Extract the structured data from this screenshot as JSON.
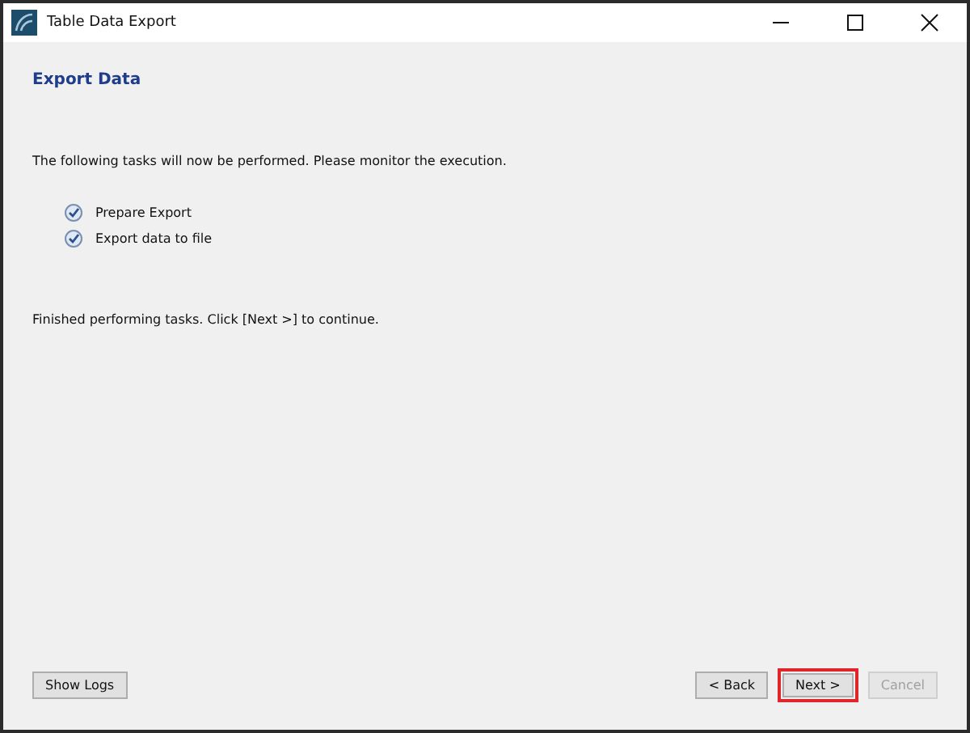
{
  "window": {
    "title": "Table Data Export"
  },
  "page_title": "Export Data",
  "intro": "The following tasks will now be performed. Please monitor the execution.",
  "tasks": [
    {
      "label": "Prepare Export",
      "checked": true
    },
    {
      "label": "Export data to file",
      "checked": true
    }
  ],
  "status": "Finished performing tasks. Click [Next >] to continue.",
  "buttons": [
    {
      "kind": "left",
      "label": "Show Logs",
      "disabled": false,
      "highlighted": false
    },
    {
      "kind": "right",
      "label": "< Back",
      "disabled": false,
      "highlighted": false
    },
    {
      "kind": "right",
      "label": "Next >",
      "disabled": false,
      "highlighted": true
    },
    {
      "kind": "right",
      "label": "Cancel",
      "disabled": true,
      "highlighted": false
    }
  ]
}
